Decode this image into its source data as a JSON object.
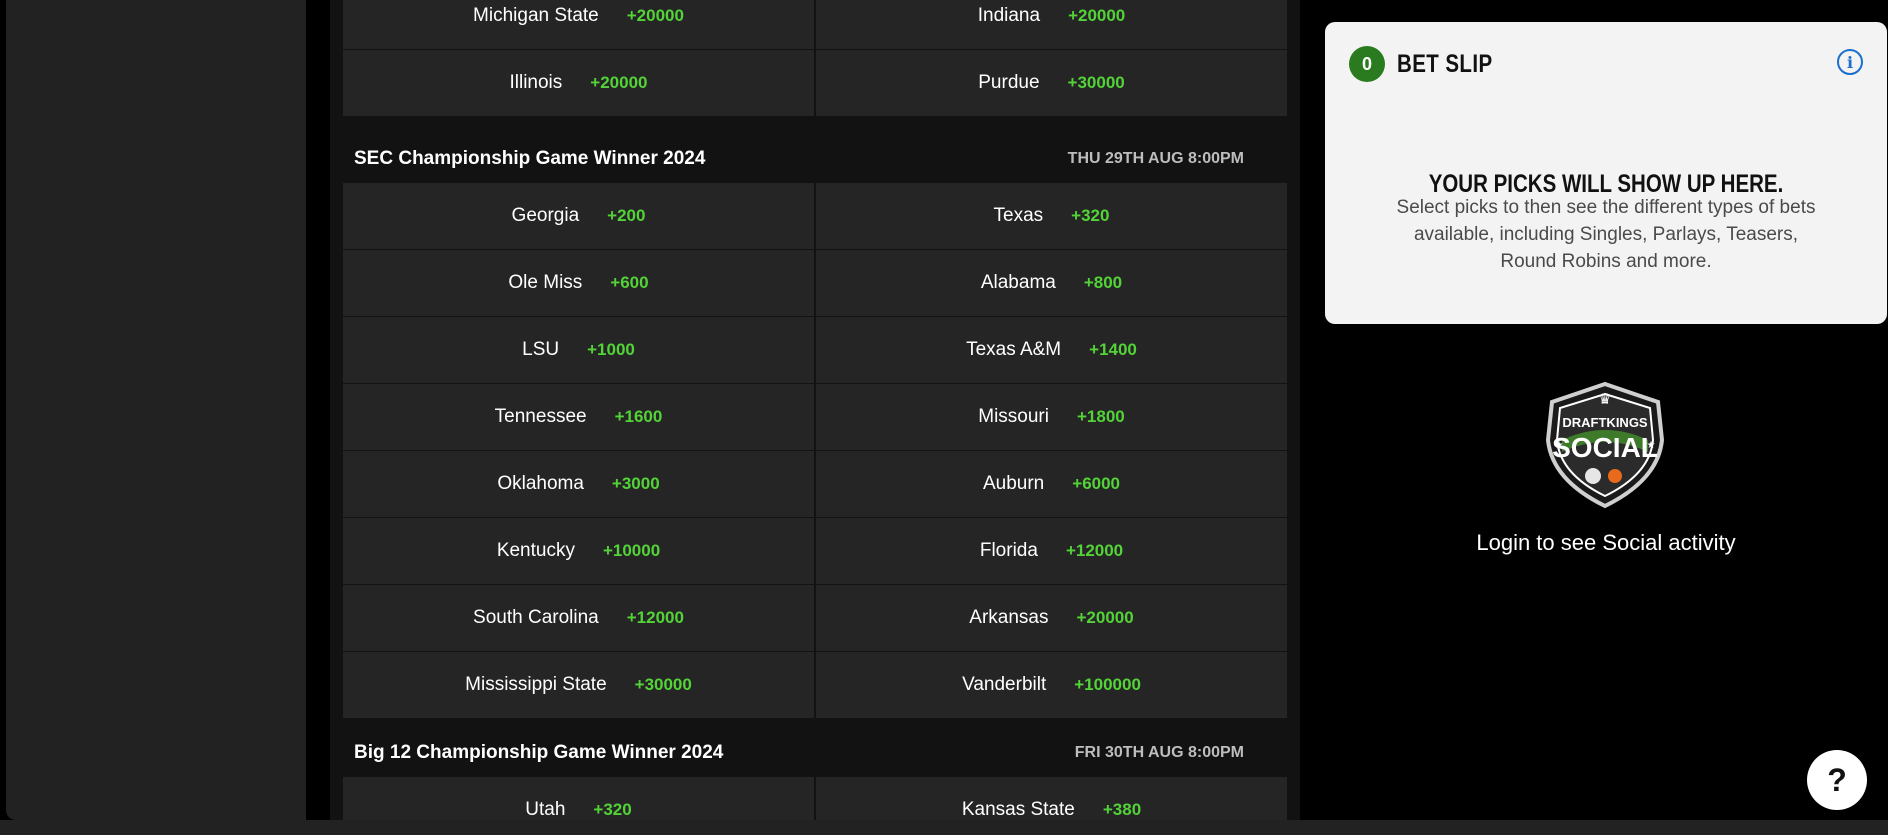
{
  "top_group": [
    {
      "left": {
        "team": "Michigan State",
        "odds": "+20000"
      },
      "right": {
        "team": "Indiana",
        "odds": "+20000"
      }
    },
    {
      "left": {
        "team": "Illinois",
        "odds": "+20000"
      },
      "right": {
        "team": "Purdue",
        "odds": "+30000"
      }
    }
  ],
  "sec": {
    "title": "SEC Championship Game Winner 2024",
    "date": "THU 29TH AUG 8:00PM",
    "rows": [
      {
        "left": {
          "team": "Georgia",
          "odds": "+200"
        },
        "right": {
          "team": "Texas",
          "odds": "+320"
        }
      },
      {
        "left": {
          "team": "Ole Miss",
          "odds": "+600"
        },
        "right": {
          "team": "Alabama",
          "odds": "+800"
        }
      },
      {
        "left": {
          "team": "LSU",
          "odds": "+1000"
        },
        "right": {
          "team": "Texas A&M",
          "odds": "+1400"
        }
      },
      {
        "left": {
          "team": "Tennessee",
          "odds": "+1600"
        },
        "right": {
          "team": "Missouri",
          "odds": "+1800"
        }
      },
      {
        "left": {
          "team": "Oklahoma",
          "odds": "+3000"
        },
        "right": {
          "team": "Auburn",
          "odds": "+6000"
        }
      },
      {
        "left": {
          "team": "Kentucky",
          "odds": "+10000"
        },
        "right": {
          "team": "Florida",
          "odds": "+12000"
        }
      },
      {
        "left": {
          "team": "South Carolina",
          "odds": "+12000"
        },
        "right": {
          "team": "Arkansas",
          "odds": "+20000"
        }
      },
      {
        "left": {
          "team": "Mississippi State",
          "odds": "+30000"
        },
        "right": {
          "team": "Vanderbilt",
          "odds": "+100000"
        }
      }
    ]
  },
  "big12": {
    "title": "Big 12 Championship Game Winner 2024",
    "date": "FRI 30TH AUG 8:00PM",
    "rows": [
      {
        "left": {
          "team": "Utah",
          "odds": "+320"
        },
        "right": {
          "team": "Kansas State",
          "odds": "+380"
        }
      }
    ]
  },
  "betslip": {
    "count": "0",
    "title": "BET SLIP",
    "info_icon": "i",
    "heading": "YOUR PICKS WILL SHOW UP HERE.",
    "description": "Select picks to then see the different types of bets available, including Singles, Parlays, Teasers, Round Robins and more."
  },
  "social": {
    "badge_top": "DRAFTKINGS",
    "badge_main": "SOCIAL",
    "login_text": "Login to see Social activity"
  },
  "help": {
    "label": "?"
  },
  "colors": {
    "odds": "#53d337",
    "badge": "#2a7a1f",
    "info": "#1a6fd0"
  }
}
